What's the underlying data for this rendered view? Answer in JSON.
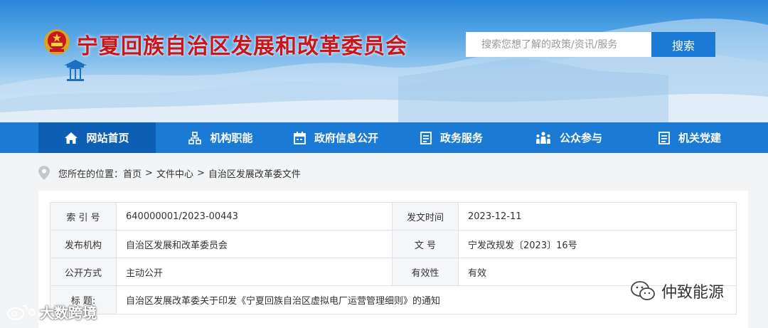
{
  "site": {
    "title": "宁夏回族自治区发展和改革委员会"
  },
  "search": {
    "placeholder": "搜索您想了解的政策/资讯/服务",
    "button_label": "搜索"
  },
  "nav": {
    "items": [
      {
        "label": "网站首页",
        "icon": "home-icon"
      },
      {
        "label": "机构职能",
        "icon": "org-chart-icon"
      },
      {
        "label": "政府信息公开",
        "icon": "calendar-icon"
      },
      {
        "label": "政务服务",
        "icon": "document-list-icon"
      },
      {
        "label": "公众参与",
        "icon": "people-icon"
      },
      {
        "label": "机关党建",
        "icon": "document-icon"
      }
    ]
  },
  "breadcrumb": {
    "prefix": "您所在的位置：",
    "items": [
      "首页",
      "文件中心",
      "自治区发展改革委文件"
    ],
    "separator": ">"
  },
  "meta": {
    "rows": [
      {
        "label1": "索 引 号",
        "value1": "640000001/2023-00443",
        "label2": "发文时间",
        "value2": "2023-12-11"
      },
      {
        "label1": "发布机构",
        "value1": "自治区发展和改革委员会",
        "label2": "文 号",
        "value2": "宁发改规发〔2023〕16号"
      },
      {
        "label1": "公开方式",
        "value1": "主动公开",
        "label2": "有效性",
        "value2": "有效"
      }
    ],
    "title_label": "标 题:",
    "title_value": "自治区发展改革委关于印发《宁夏回族自治区虚拟电厂运营管理细则》的通知"
  },
  "watermarks": {
    "right": "仲致能源",
    "left": "大数跨境"
  },
  "colors": {
    "nav_bg": "#1a7ad4",
    "nav_active": "#0d5fb4",
    "title_red": "#c8161d",
    "search_button": "#1b7ad6"
  }
}
